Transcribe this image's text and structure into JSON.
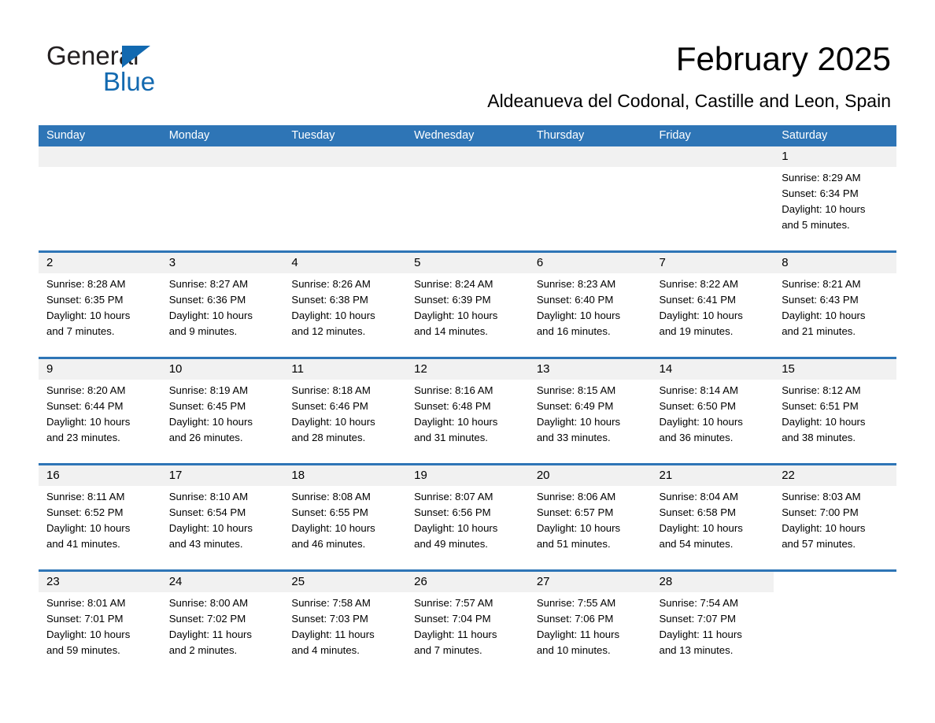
{
  "brand": {
    "name_part1": "General",
    "name_part2": "Blue",
    "triangle_icon": "triangle-icon",
    "accent_color": "#1269b0"
  },
  "header": {
    "title": "February 2025",
    "subtitle": "Aldeanueva del Codonal, Castille and Leon, Spain"
  },
  "calendar": {
    "header_bg": "#2e75b6",
    "day_band_bg": "#f1f1f1",
    "weekdays": [
      "Sunday",
      "Monday",
      "Tuesday",
      "Wednesday",
      "Thursday",
      "Friday",
      "Saturday"
    ],
    "labels": {
      "sunrise": "Sunrise:",
      "sunset": "Sunset:",
      "daylight": "Daylight:"
    },
    "weeks": [
      [
        {
          "day": ""
        },
        {
          "day": ""
        },
        {
          "day": ""
        },
        {
          "day": ""
        },
        {
          "day": ""
        },
        {
          "day": ""
        },
        {
          "day": "1",
          "sunrise": "Sunrise: 8:29 AM",
          "sunset": "Sunset: 6:34 PM",
          "daylight_1": "Daylight: 10 hours",
          "daylight_2": "and 5 minutes."
        }
      ],
      [
        {
          "day": "2",
          "sunrise": "Sunrise: 8:28 AM",
          "sunset": "Sunset: 6:35 PM",
          "daylight_1": "Daylight: 10 hours",
          "daylight_2": "and 7 minutes."
        },
        {
          "day": "3",
          "sunrise": "Sunrise: 8:27 AM",
          "sunset": "Sunset: 6:36 PM",
          "daylight_1": "Daylight: 10 hours",
          "daylight_2": "and 9 minutes."
        },
        {
          "day": "4",
          "sunrise": "Sunrise: 8:26 AM",
          "sunset": "Sunset: 6:38 PM",
          "daylight_1": "Daylight: 10 hours",
          "daylight_2": "and 12 minutes."
        },
        {
          "day": "5",
          "sunrise": "Sunrise: 8:24 AM",
          "sunset": "Sunset: 6:39 PM",
          "daylight_1": "Daylight: 10 hours",
          "daylight_2": "and 14 minutes."
        },
        {
          "day": "6",
          "sunrise": "Sunrise: 8:23 AM",
          "sunset": "Sunset: 6:40 PM",
          "daylight_1": "Daylight: 10 hours",
          "daylight_2": "and 16 minutes."
        },
        {
          "day": "7",
          "sunrise": "Sunrise: 8:22 AM",
          "sunset": "Sunset: 6:41 PM",
          "daylight_1": "Daylight: 10 hours",
          "daylight_2": "and 19 minutes."
        },
        {
          "day": "8",
          "sunrise": "Sunrise: 8:21 AM",
          "sunset": "Sunset: 6:43 PM",
          "daylight_1": "Daylight: 10 hours",
          "daylight_2": "and 21 minutes."
        }
      ],
      [
        {
          "day": "9",
          "sunrise": "Sunrise: 8:20 AM",
          "sunset": "Sunset: 6:44 PM",
          "daylight_1": "Daylight: 10 hours",
          "daylight_2": "and 23 minutes."
        },
        {
          "day": "10",
          "sunrise": "Sunrise: 8:19 AM",
          "sunset": "Sunset: 6:45 PM",
          "daylight_1": "Daylight: 10 hours",
          "daylight_2": "and 26 minutes."
        },
        {
          "day": "11",
          "sunrise": "Sunrise: 8:18 AM",
          "sunset": "Sunset: 6:46 PM",
          "daylight_1": "Daylight: 10 hours",
          "daylight_2": "and 28 minutes."
        },
        {
          "day": "12",
          "sunrise": "Sunrise: 8:16 AM",
          "sunset": "Sunset: 6:48 PM",
          "daylight_1": "Daylight: 10 hours",
          "daylight_2": "and 31 minutes."
        },
        {
          "day": "13",
          "sunrise": "Sunrise: 8:15 AM",
          "sunset": "Sunset: 6:49 PM",
          "daylight_1": "Daylight: 10 hours",
          "daylight_2": "and 33 minutes."
        },
        {
          "day": "14",
          "sunrise": "Sunrise: 8:14 AM",
          "sunset": "Sunset: 6:50 PM",
          "daylight_1": "Daylight: 10 hours",
          "daylight_2": "and 36 minutes."
        },
        {
          "day": "15",
          "sunrise": "Sunrise: 8:12 AM",
          "sunset": "Sunset: 6:51 PM",
          "daylight_1": "Daylight: 10 hours",
          "daylight_2": "and 38 minutes."
        }
      ],
      [
        {
          "day": "16",
          "sunrise": "Sunrise: 8:11 AM",
          "sunset": "Sunset: 6:52 PM",
          "daylight_1": "Daylight: 10 hours",
          "daylight_2": "and 41 minutes."
        },
        {
          "day": "17",
          "sunrise": "Sunrise: 8:10 AM",
          "sunset": "Sunset: 6:54 PM",
          "daylight_1": "Daylight: 10 hours",
          "daylight_2": "and 43 minutes."
        },
        {
          "day": "18",
          "sunrise": "Sunrise: 8:08 AM",
          "sunset": "Sunset: 6:55 PM",
          "daylight_1": "Daylight: 10 hours",
          "daylight_2": "and 46 minutes."
        },
        {
          "day": "19",
          "sunrise": "Sunrise: 8:07 AM",
          "sunset": "Sunset: 6:56 PM",
          "daylight_1": "Daylight: 10 hours",
          "daylight_2": "and 49 minutes."
        },
        {
          "day": "20",
          "sunrise": "Sunrise: 8:06 AM",
          "sunset": "Sunset: 6:57 PM",
          "daylight_1": "Daylight: 10 hours",
          "daylight_2": "and 51 minutes."
        },
        {
          "day": "21",
          "sunrise": "Sunrise: 8:04 AM",
          "sunset": "Sunset: 6:58 PM",
          "daylight_1": "Daylight: 10 hours",
          "daylight_2": "and 54 minutes."
        },
        {
          "day": "22",
          "sunrise": "Sunrise: 8:03 AM",
          "sunset": "Sunset: 7:00 PM",
          "daylight_1": "Daylight: 10 hours",
          "daylight_2": "and 57 minutes."
        }
      ],
      [
        {
          "day": "23",
          "sunrise": "Sunrise: 8:01 AM",
          "sunset": "Sunset: 7:01 PM",
          "daylight_1": "Daylight: 10 hours",
          "daylight_2": "and 59 minutes."
        },
        {
          "day": "24",
          "sunrise": "Sunrise: 8:00 AM",
          "sunset": "Sunset: 7:02 PM",
          "daylight_1": "Daylight: 11 hours",
          "daylight_2": "and 2 minutes."
        },
        {
          "day": "25",
          "sunrise": "Sunrise: 7:58 AM",
          "sunset": "Sunset: 7:03 PM",
          "daylight_1": "Daylight: 11 hours",
          "daylight_2": "and 4 minutes."
        },
        {
          "day": "26",
          "sunrise": "Sunrise: 7:57 AM",
          "sunset": "Sunset: 7:04 PM",
          "daylight_1": "Daylight: 11 hours",
          "daylight_2": "and 7 minutes."
        },
        {
          "day": "27",
          "sunrise": "Sunrise: 7:55 AM",
          "sunset": "Sunset: 7:06 PM",
          "daylight_1": "Daylight: 11 hours",
          "daylight_2": "and 10 minutes."
        },
        {
          "day": "28",
          "sunrise": "Sunrise: 7:54 AM",
          "sunset": "Sunset: 7:07 PM",
          "daylight_1": "Daylight: 11 hours",
          "daylight_2": "and 13 minutes."
        },
        {
          "day": ""
        }
      ]
    ]
  }
}
